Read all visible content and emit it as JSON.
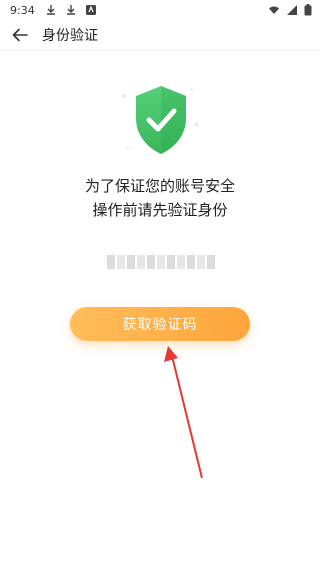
{
  "status_bar": {
    "time": "9:34",
    "icons": [
      "download-icon",
      "download-icon",
      "notification-icon"
    ],
    "right_icons": [
      "wifi-icon",
      "signal-icon",
      "battery-icon"
    ]
  },
  "header": {
    "title": "身份验证",
    "back_icon": "back-arrow-icon"
  },
  "main": {
    "shield_icon": "shield-check-icon",
    "message_line1": "为了保证您的账号安全",
    "message_line2": "操作前请先验证身份",
    "masked_account": "",
    "button_label": "获取验证码"
  },
  "colors": {
    "shield_green": "#46c56b",
    "button_orange": "#ffa53b",
    "annotation_red": "#e53935"
  }
}
